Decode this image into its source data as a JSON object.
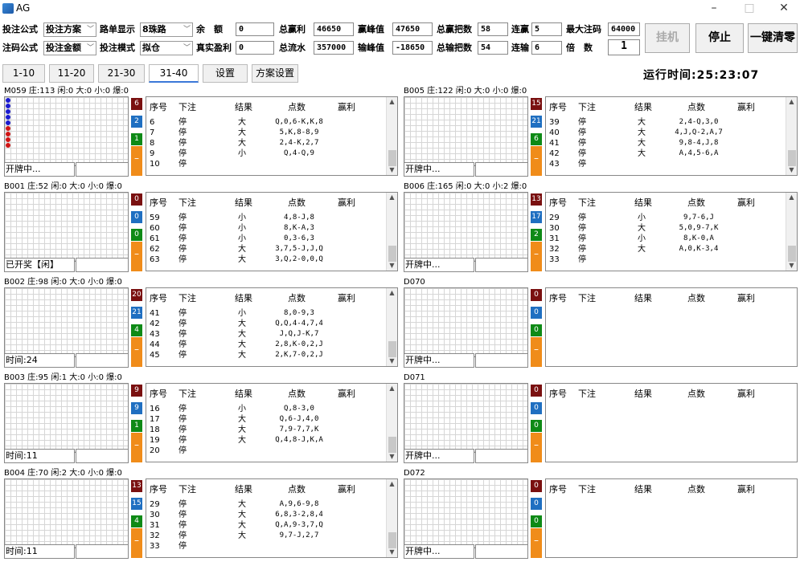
{
  "window": {
    "title": "AG",
    "minimize": "–",
    "maximize": "□",
    "close": "✕"
  },
  "controls": {
    "r1": {
      "formula_label": "投注公式",
      "formula_val": "投注方案",
      "road_label": "路单显示",
      "road_val": "8珠路",
      "balance_label": "余　额",
      "balance_val": "0",
      "total_win_label": "总赢利",
      "total_win_val": "46650",
      "peak_win_label": "赢峰值",
      "peak_win_val": "47650",
      "total_win_hands_label": "总赢把数",
      "total_win_hands_val": "58",
      "streak_win_label": "连赢",
      "streak_win_val": "5",
      "max_bet_label": "最大注码",
      "max_bet_val": "64000"
    },
    "r2": {
      "formula_label": "注码公式",
      "formula_val": "投注金额",
      "mode_label": "投注模式",
      "mode_val": "拟仓",
      "real_profit_label": "真实盈利",
      "real_profit_val": "0",
      "total_flow_label": "总流水",
      "total_flow_val": "357000",
      "peak_loss_label": "输峰值",
      "peak_loss_val": "-18650",
      "total_loss_hands_label": "总输把数",
      "total_loss_hands_val": "54",
      "streak_loss_label": "连输",
      "streak_loss_val": "6",
      "multiplier_label": "倍　数",
      "multiplier_val": "1"
    },
    "buttons": {
      "hangup": "挂机",
      "stop": "停止",
      "clear": "一键清零"
    }
  },
  "tabs": [
    "1-10",
    "11-20",
    "21-30",
    "31-40",
    "设置",
    "方案设置"
  ],
  "runtime": "运行时间:25:23:07",
  "table_headers": [
    "序号",
    "下注",
    "结果",
    "点数",
    "赢利"
  ],
  "panels": [
    {
      "title": "M059 庄:113 闲:0 大:0 小:0 爆:0",
      "status": "开牌中...",
      "badges": [
        "6",
        "2",
        "1"
      ],
      "rows": [
        [
          "6",
          "停",
          "大",
          "Q,0,6-K,K,8"
        ],
        [
          "7",
          "停",
          "大",
          "5,K,8-8,9"
        ],
        [
          "8",
          "停",
          "大",
          "2,4-K,2,7"
        ],
        [
          "9",
          "停",
          "小",
          "Q,4-Q,9"
        ],
        [
          "10",
          "停",
          "",
          ""
        ]
      ]
    },
    {
      "title": "B005 庄:122 闲:0 大:0 小:0 爆:0",
      "status": "开牌中...",
      "badges": [
        "15",
        "21",
        "6"
      ],
      "rows": [
        [
          "39",
          "停",
          "大",
          "2,4-Q,3,0"
        ],
        [
          "40",
          "停",
          "大",
          "4,J,Q-2,A,7"
        ],
        [
          "41",
          "停",
          "大",
          "9,8-4,J,8"
        ],
        [
          "42",
          "停",
          "大",
          "A,4,5-6,A"
        ],
        [
          "43",
          "停",
          "",
          ""
        ]
      ]
    },
    {
      "title": "B001 庄:52 闲:0 大:0 小:0 爆:0",
      "status": "已开奖【闲】",
      "badges": [
        "0",
        "0",
        "0"
      ],
      "rows": [
        [
          "59",
          "停",
          "小",
          "4,8-J,8"
        ],
        [
          "60",
          "停",
          "小",
          "8,K-A,3"
        ],
        [
          "61",
          "停",
          "小",
          "0,3-6,3"
        ],
        [
          "62",
          "停",
          "大",
          "3,7,5-J,J,Q"
        ],
        [
          "63",
          "停",
          "大",
          "3,Q,2-0,0,Q"
        ]
      ]
    },
    {
      "title": "B006 庄:165 闲:0 大:0 小:2 爆:0",
      "status": "开牌中...",
      "badges": [
        "13",
        "17",
        "2"
      ],
      "rows": [
        [
          "29",
          "停",
          "小",
          "9,7-6,J"
        ],
        [
          "30",
          "停",
          "大",
          "5,0,9-7,K"
        ],
        [
          "31",
          "停",
          "小",
          "8,K-0,A"
        ],
        [
          "32",
          "停",
          "大",
          "A,0,K-3,4"
        ],
        [
          "33",
          "停",
          "",
          ""
        ]
      ]
    },
    {
      "title": "B002 庄:98 闲:0 大:0 小:0 爆:0",
      "status": "时间:24",
      "badges": [
        "20",
        "21",
        "4"
      ],
      "rows": [
        [
          "41",
          "停",
          "小",
          "8,0-9,3"
        ],
        [
          "42",
          "停",
          "大",
          "Q,Q,4-4,7,4"
        ],
        [
          "43",
          "停",
          "大",
          "J,Q,J-K,7"
        ],
        [
          "44",
          "停",
          "大",
          "2,8,K-0,2,J"
        ],
        [
          "45",
          "停",
          "大",
          "2,K,7-0,2,J"
        ]
      ]
    },
    {
      "title": "D070",
      "status": "开牌中...",
      "badges": [
        "0",
        "0",
        "0"
      ],
      "rows": []
    },
    {
      "title": "B003 庄:95 闲:1 大:0 小:0 爆:0",
      "status": "时间:11",
      "badges": [
        "9",
        "9",
        "1"
      ],
      "rows": [
        [
          "16",
          "停",
          "小",
          "Q,8-3,0"
        ],
        [
          "17",
          "停",
          "大",
          "Q,6-J,4,0"
        ],
        [
          "18",
          "停",
          "大",
          "7,9-7,7,K"
        ],
        [
          "19",
          "停",
          "大",
          "Q,4,8-J,K,A"
        ],
        [
          "20",
          "停",
          "",
          ""
        ]
      ]
    },
    {
      "title": "D071",
      "status": "开牌中...",
      "badges": [
        "0",
        "0",
        "0"
      ],
      "rows": []
    },
    {
      "title": "B004 庄:70 闲:2 大:0 小:0 爆:0",
      "status": "时间:11",
      "badges": [
        "13",
        "15",
        "4"
      ],
      "rows": [
        [
          "29",
          "停",
          "大",
          "A,9,6-9,8"
        ],
        [
          "30",
          "停",
          "大",
          "6,8,3-2,8,4"
        ],
        [
          "31",
          "停",
          "大",
          "Q,A,9-3,7,Q"
        ],
        [
          "32",
          "停",
          "大",
          "9,7-J,2,7"
        ],
        [
          "33",
          "停",
          "",
          ""
        ]
      ]
    },
    {
      "title": "D072",
      "status": "开牌中...",
      "badges": [
        "0",
        "0",
        "0"
      ],
      "rows": []
    }
  ],
  "dot_patterns": [
    [
      "b",
      "b",
      "b",
      "b",
      "b",
      "r",
      "r",
      "r",
      "r"
    ],
    [],
    [],
    [],
    [],
    [],
    [],
    [],
    [],
    []
  ],
  "colors": {
    "badge_red": "#7a1010",
    "badge_blue": "#1f6fc1",
    "badge_green": "#0e8a16",
    "orange": "#f08c1a",
    "banker": "#d01515",
    "player": "#1a1ad0"
  }
}
